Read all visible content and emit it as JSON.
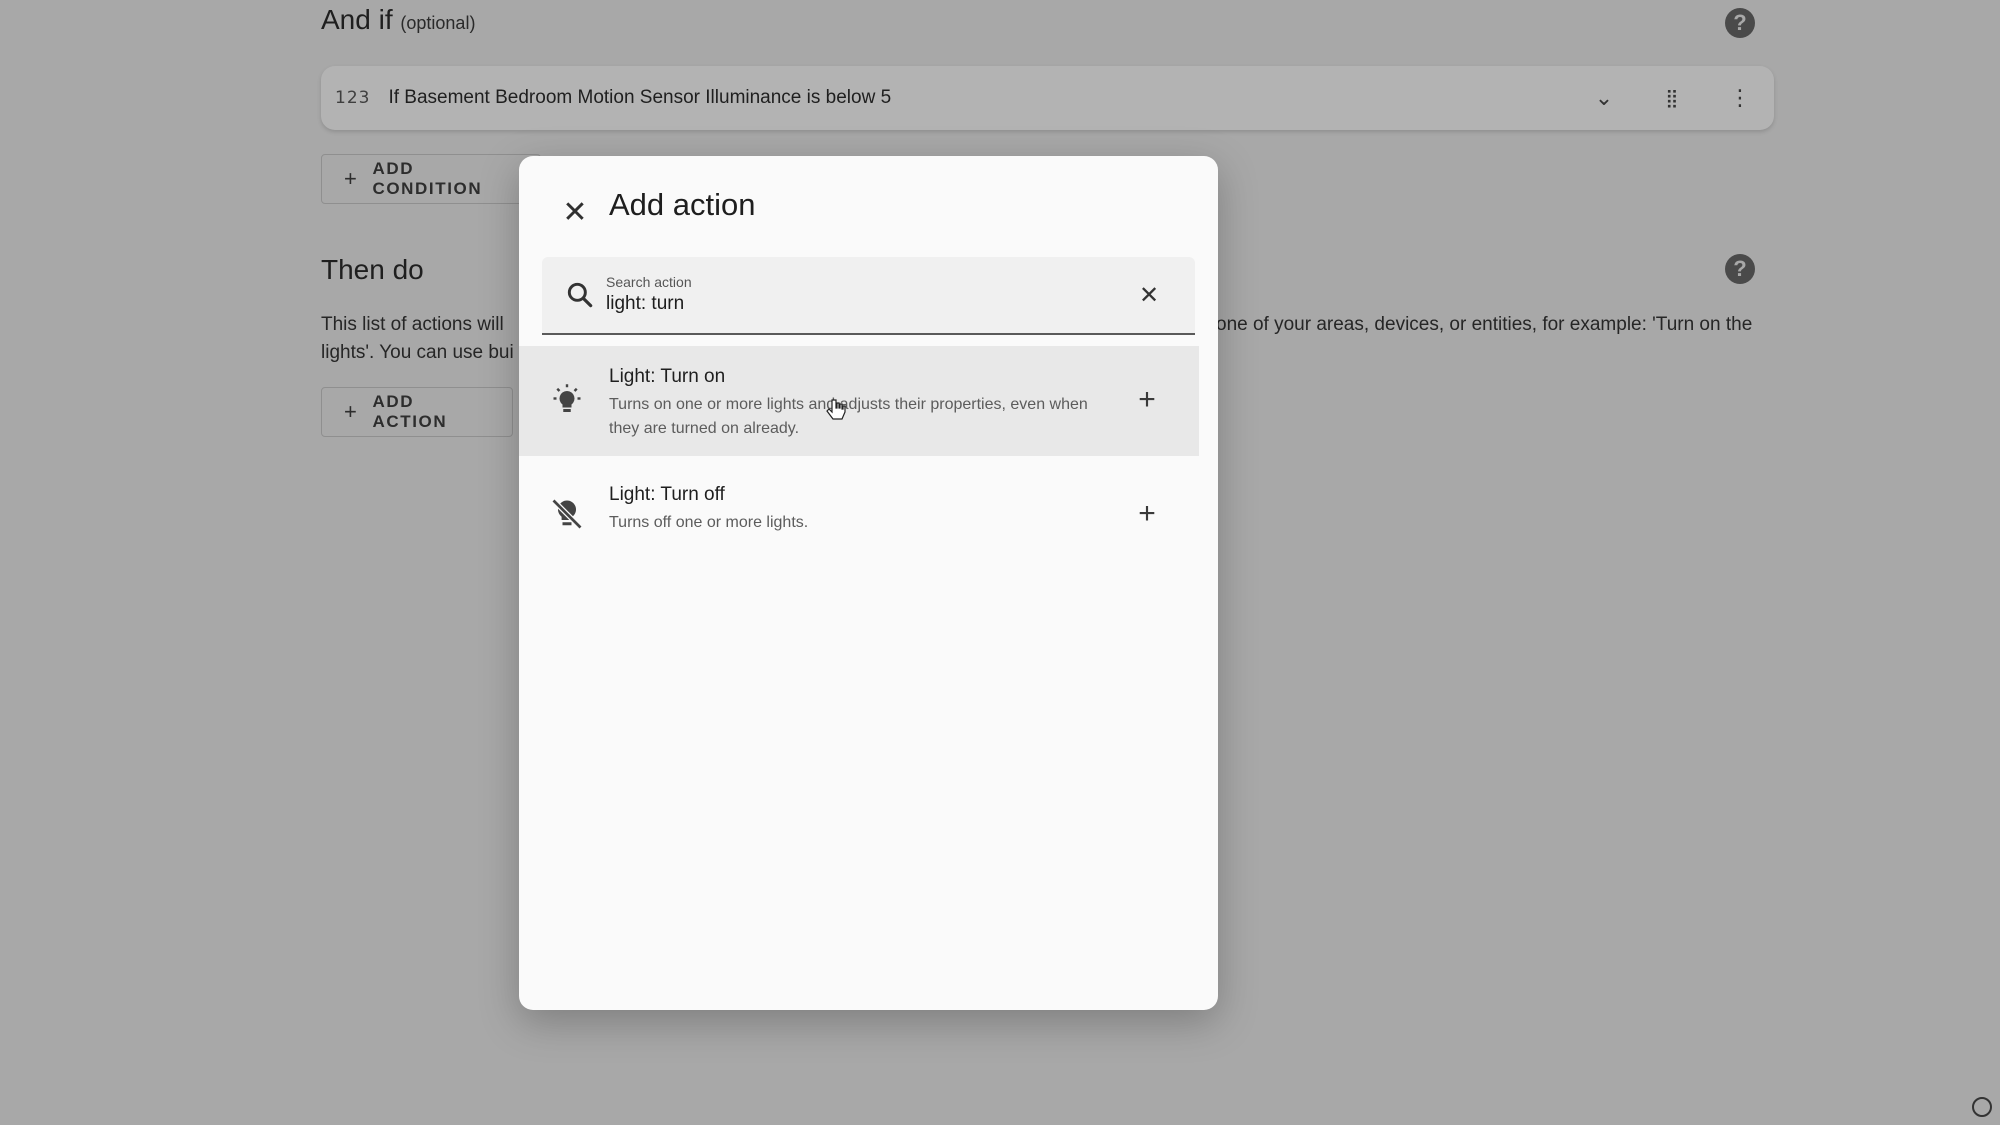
{
  "background": {
    "and_if": {
      "title": "And if",
      "optional": "(optional)"
    },
    "condition": {
      "number_icon": "123",
      "text": "If Basement Bedroom Motion Sensor Illuminance is below 5"
    },
    "add_condition_label": "ADD CONDITION",
    "then_do": {
      "title": "Then do"
    },
    "description_left_line1": "This list of actions will",
    "description_left_line2": "lights'. You can use bui",
    "description_right_line1": "one of your areas, devices, or entities, for example: 'Turn on the",
    "add_action_label": "ADD ACTION"
  },
  "dialog": {
    "title": "Add action",
    "search": {
      "label": "Search action",
      "value": "light: turn"
    },
    "items": [
      {
        "title": "Light: Turn on",
        "description": "Turns on one or more lights and adjusts their properties, even when they are turned on already."
      },
      {
        "title": "Light: Turn off",
        "description": "Turns off one or more lights."
      }
    ]
  },
  "icons": {
    "close": "close-icon",
    "search": "search-icon",
    "clear": "clear-icon",
    "lightbulb": "lightbulb-on-icon",
    "lightbulb_off": "lightbulb-off-icon",
    "add": "plus-icon",
    "help": "help-circle-icon",
    "chevron": "chevron-down-icon",
    "drag": "drag-grid-icon",
    "more": "dots-vertical-icon"
  }
}
